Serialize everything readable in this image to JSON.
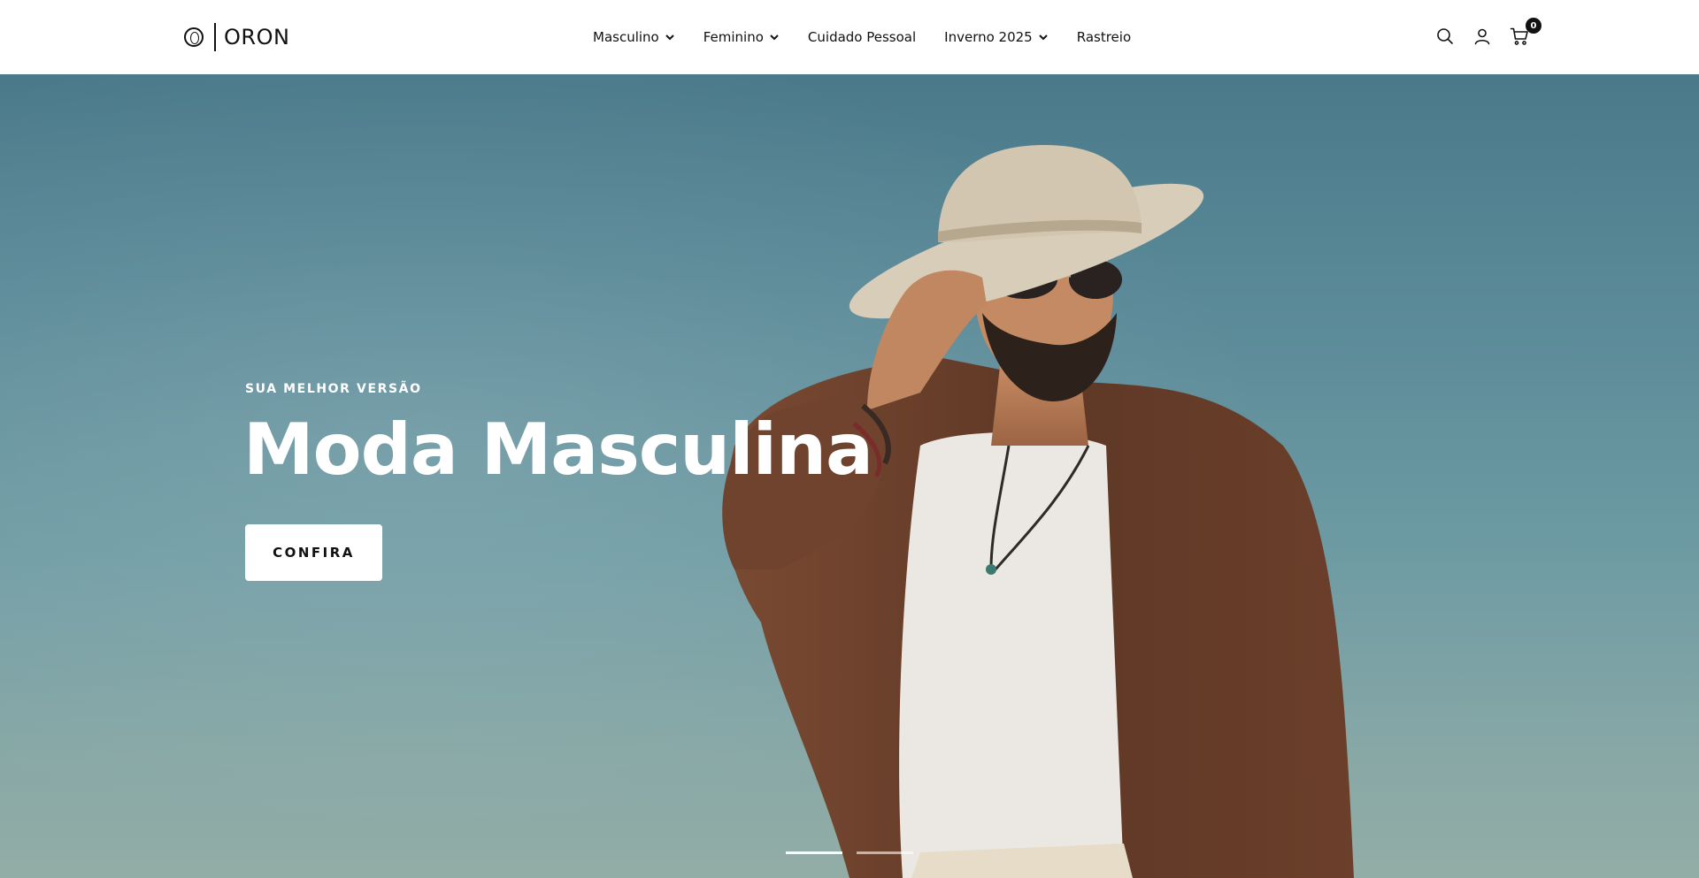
{
  "brand": {
    "name": "ORON"
  },
  "nav": {
    "items": [
      {
        "label": "Masculino",
        "has_dropdown": true
      },
      {
        "label": "Feminino",
        "has_dropdown": true
      },
      {
        "label": "Cuidado Pessoal",
        "has_dropdown": false
      },
      {
        "label": "Inverno 2025",
        "has_dropdown": true
      },
      {
        "label": "Rastreio",
        "has_dropdown": false
      }
    ]
  },
  "header_icons": {
    "search": "search-icon",
    "account": "user-icon",
    "cart": "cart-icon",
    "cart_count": "0"
  },
  "hero": {
    "eyebrow": "SUA MELHOR VERSÃO",
    "title": "Moda Masculina",
    "cta_label": "CONFIRA",
    "slides_total": 2,
    "slide_active": 1
  },
  "colors": {
    "header_bg": "#ffffff",
    "text": "#111111",
    "hero_sky": "#5b8a98",
    "jacket": "#6b3f2a",
    "hat": "#d8cdb8",
    "cta_bg": "#ffffff"
  }
}
